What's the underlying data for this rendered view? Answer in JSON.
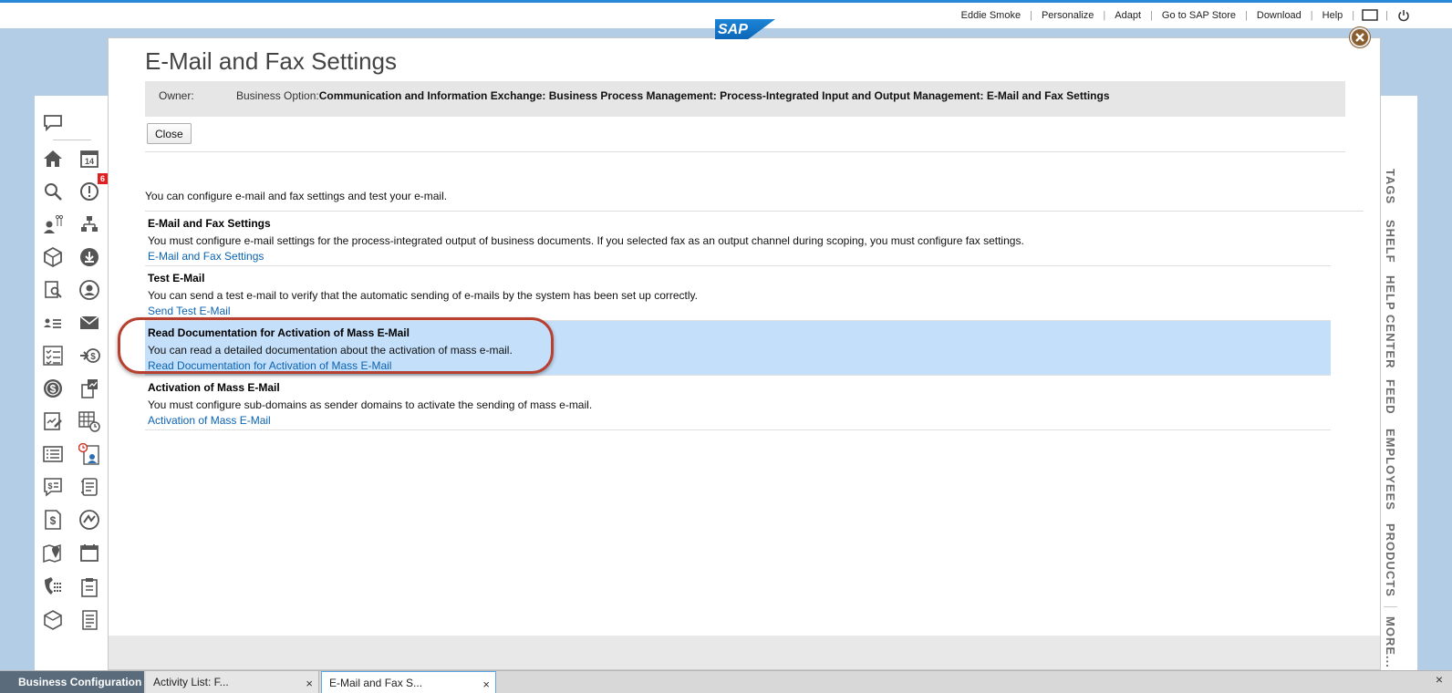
{
  "top_nav": {
    "user": "Eddie Smoke",
    "personalize": "Personalize",
    "adapt": "Adapt",
    "store": "Go to SAP Store",
    "download": "Download",
    "help": "Help",
    "separator": "|"
  },
  "logo_text": "SAP",
  "left_rail": {
    "notification_count": "6",
    "calendar_day": "14"
  },
  "right_rail_tabs": [
    "TAGS",
    "SHELF",
    "HELP CENTER",
    "FEED",
    "EMPLOYEES",
    "PRODUCTS",
    "MORE..."
  ],
  "dialog": {
    "title": "E-Mail and Fax Settings",
    "owner_label": "Owner:",
    "business_option_label": "Business Option:",
    "business_option_value": "Communication and Information Exchange: Business Process Management: Process-Integrated Input and Output Management: E-Mail and Fax Settings",
    "close_label": "Close",
    "intro": "You can configure e-mail and fax settings and test your e-mail.",
    "items": [
      {
        "title": "E-Mail and Fax Settings",
        "description": "You must configure e-mail settings for the process-integrated output of business documents. If you selected fax as an output channel during scoping, you must configure fax settings.",
        "link": "E-Mail and Fax Settings"
      },
      {
        "title": "Test E-Mail",
        "description": "You can send a test e-mail to verify that the automatic sending of e-mails by the system has been set up correctly.",
        "link": "Send Test E-Mail"
      },
      {
        "title": "Read Documentation for Activation of Mass E-Mail",
        "description": "You can read a detailed documentation about the activation of mass e-mail.",
        "link": "Read Documentation for Activation of Mass E-Mail"
      },
      {
        "title": "Activation of Mass E-Mail",
        "description": "You must configure sub-domains as sender domains to activate the sending of mass e-mail.",
        "link": "Activation of Mass E-Mail"
      }
    ]
  },
  "taskbar": {
    "tabs": [
      "Business Configuration",
      "Activity List: F...",
      "E-Mail and Fax S..."
    ],
    "close_glyph": "×"
  },
  "colors": {
    "highlight_row": "#c4dffa",
    "link": "#0a63b2",
    "annotation": "#b84030",
    "page_background": "#b3cde6"
  }
}
